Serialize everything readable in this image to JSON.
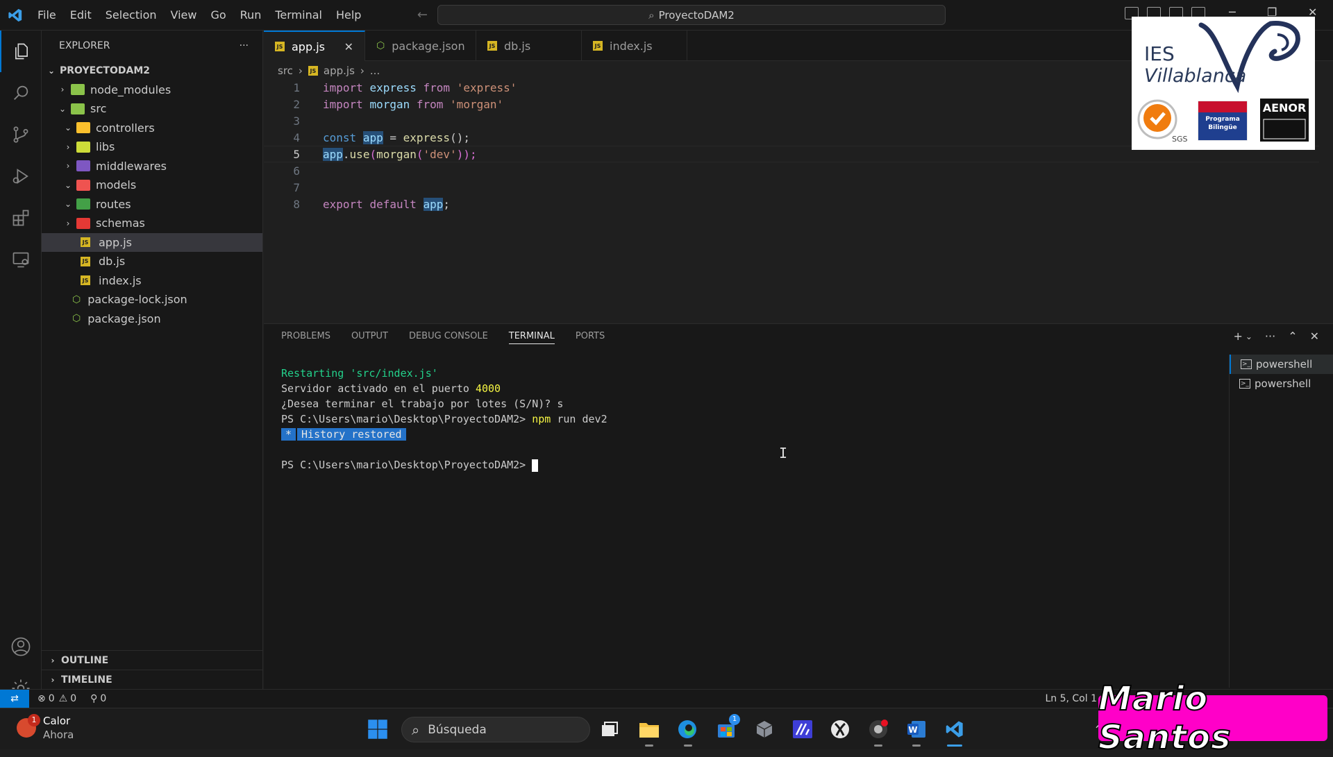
{
  "menu": [
    "File",
    "Edit",
    "Selection",
    "View",
    "Go",
    "Run",
    "Terminal",
    "Help"
  ],
  "command_center": "ProyectoDAM2",
  "explorer": {
    "title": "EXPLORER",
    "root": "PROYECTODAM2",
    "items": [
      {
        "label": "node_modules",
        "kind": "folder",
        "color": "#8bc34a",
        "expanded": false
      },
      {
        "label": "src",
        "kind": "folder",
        "color": "#8bc34a",
        "expanded": true
      },
      {
        "label": "controllers",
        "kind": "folder",
        "color": "#fbc02d",
        "expanded": true
      },
      {
        "label": "libs",
        "kind": "folder",
        "color": "#cddc39",
        "expanded": false
      },
      {
        "label": "middlewares",
        "kind": "folder",
        "color": "#7e57c2",
        "expanded": false
      },
      {
        "label": "models",
        "kind": "folder",
        "color": "#ef5350",
        "expanded": true
      },
      {
        "label": "routes",
        "kind": "folder",
        "color": "#43a047",
        "expanded": true
      },
      {
        "label": "schemas",
        "kind": "folder",
        "color": "#e53935",
        "expanded": false
      },
      {
        "label": "app.js",
        "kind": "js"
      },
      {
        "label": "db.js",
        "kind": "js"
      },
      {
        "label": "index.js",
        "kind": "js"
      },
      {
        "label": "package-lock.json",
        "kind": "json"
      },
      {
        "label": "package.json",
        "kind": "json"
      }
    ],
    "outline": "OUTLINE",
    "timeline": "TIMELINE"
  },
  "tabs": [
    {
      "label": "app.js",
      "kind": "js"
    },
    {
      "label": "package.json",
      "kind": "json"
    },
    {
      "label": "db.js",
      "kind": "js"
    },
    {
      "label": "index.js",
      "kind": "js"
    }
  ],
  "breadcrumb": {
    "folder": "src",
    "file": "app.js",
    "more": "..."
  },
  "code": {
    "line_numbers": [
      "1",
      "2",
      "3",
      "4",
      "5",
      "6",
      "7",
      "8"
    ],
    "l1": {
      "kw": "import",
      "id": "express",
      "from": "from",
      "str": "'express'"
    },
    "l2": {
      "kw": "import",
      "id": "morgan",
      "from": "from",
      "str": "'morgan'"
    },
    "l4": {
      "kw": "const",
      "id": "app",
      "eq": " = ",
      "fn": "express",
      "end": "();"
    },
    "l5": {
      "id": "app",
      "dot": ".",
      "fn": "use",
      "p1": "(",
      "fn2": "morgan",
      "p2": "(",
      "str": "'dev'",
      "end": "));"
    },
    "l8": {
      "kw": "export",
      "kw2": "default",
      "id": "app",
      "end": ";"
    }
  },
  "panel": {
    "tabs": [
      "PROBLEMS",
      "OUTPUT",
      "DEBUG CONSOLE",
      "TERMINAL",
      "PORTS"
    ],
    "active_tab": "TERMINAL",
    "terminal": {
      "restarting": "Restarting 'src/index.js'",
      "server_prefix": "Servidor activado en el puerto ",
      "server_port": "4000",
      "batch": "¿Desea terminar el trabajo por lotes (S/N)? s",
      "prompt1": "PS C:\\Users\\mario\\Desktop\\ProyectoDAM2> ",
      "cmd_npm": "npm",
      "cmd_rest": " run dev2",
      "history_star": "*",
      "history": "History restored",
      "prompt2": "PS C:\\Users\\mario\\Desktop\\ProyectoDAM2> "
    },
    "terminals": [
      "powershell",
      "powershell"
    ]
  },
  "status": {
    "errors": "0",
    "warnings": "0",
    "ports": "0",
    "position": "Ln 5, Col 1"
  },
  "taskbar": {
    "weather_title": "Calor",
    "weather_sub": "Ahora",
    "weather_badge": "1",
    "search_placeholder": "Búsqueda",
    "store_badge": "1"
  },
  "overlay": {
    "ies_line1": "IES",
    "ies_line2": "Villablanca",
    "badge_sgs": "SGS",
    "badge_bilingue_l1": "Programa",
    "badge_bilingue_l2": "Bilingüe",
    "badge_aenor": "AENOR",
    "watermark": "Mario Santos"
  },
  "colors": {
    "accent": "#0078d4",
    "background": "#1f1f1f",
    "watermark_bg": "#ff00c8"
  }
}
